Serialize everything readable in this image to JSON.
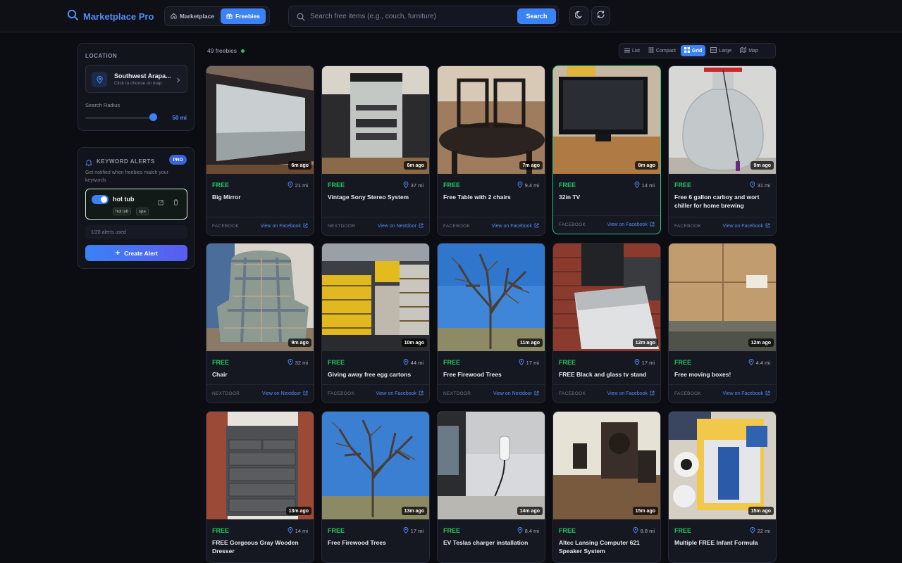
{
  "app": {
    "title": "Marketplace Pro",
    "brand_color": "#4f8cf7"
  },
  "nav": {
    "marketplace_label": "Marketplace",
    "freebies_label": "Freebies",
    "active": "Freebies"
  },
  "search": {
    "placeholder": "Search free items (e.g., couch, furniture)",
    "value": "",
    "button_label": "Search"
  },
  "header_actions": {
    "theme_icon": "moon-icon",
    "refresh_icon": "refresh-icon"
  },
  "sidebar": {
    "location": {
      "heading": "LOCATION",
      "name": "Southwest Arapa...",
      "hint": "Click to choose on map",
      "radius_label": "Search Radius",
      "radius_value": "50 mi",
      "radius_fraction": 0.96
    },
    "alerts": {
      "heading": "KEYWORD ALERTS",
      "badge": "PRO",
      "description": "Get notified when freebies match your keywords",
      "items": [
        {
          "name": "hot tub",
          "enabled": true,
          "tags": [
            "hot tub",
            "spa"
          ]
        }
      ],
      "usage": "1/20 alerts used",
      "create_label": "Create Alert"
    }
  },
  "results": {
    "count_label": "49 freebies",
    "status_color": "#22c55e"
  },
  "views": {
    "options": [
      "List",
      "Compact",
      "Grid",
      "Large",
      "Map"
    ],
    "active": "Grid"
  },
  "items": [
    {
      "price": "FREE",
      "title": "Big Mirror",
      "distance": "21 mi",
      "time": "6m ago",
      "source": "FACEBOOK",
      "link": "View on Facebook"
    },
    {
      "price": "FREE",
      "title": "Vintage Sony Stereo System",
      "distance": "37 mi",
      "time": "6m ago",
      "source": "NEXTDOOR",
      "link": "View on Nextdoor"
    },
    {
      "price": "FREE",
      "title": "Free Table with 2 chairs",
      "distance": "9.4 mi",
      "time": "7m ago",
      "source": "FACEBOOK",
      "link": "View on Facebook"
    },
    {
      "price": "FREE",
      "title": "32in TV",
      "distance": "14 mi",
      "time": "8m ago",
      "source": "FACEBOOK",
      "link": "View on Facebook"
    },
    {
      "price": "FREE",
      "title": "Free 6 gallon carboy and wort chiller for home brewing",
      "distance": "31 mi",
      "time": "9m ago",
      "source": "FACEBOOK",
      "link": "View on Facebook"
    },
    {
      "price": "FREE",
      "title": "Chair",
      "distance": "32 mi",
      "time": "9m ago",
      "source": "NEXTDOOR",
      "link": "View on Nextdoor"
    },
    {
      "price": "FREE",
      "title": "Giving away free egg cartons",
      "distance": "44 mi",
      "time": "10m ago",
      "source": "FACEBOOK",
      "link": "View on Facebook"
    },
    {
      "price": "FREE",
      "title": "Free Firewood Trees",
      "distance": "17 mi",
      "time": "11m ago",
      "source": "NEXTDOOR",
      "link": "View on Nextdoor"
    },
    {
      "price": "FREE",
      "title": "FREE Black and glass tv stand",
      "distance": "17 mi",
      "time": "12m ago",
      "source": "FACEBOOK",
      "link": "View on Facebook"
    },
    {
      "price": "FREE",
      "title": "Free moving boxes!",
      "distance": "4.4 mi",
      "time": "12m ago",
      "source": "FACEBOOK",
      "link": "View on Facebook"
    },
    {
      "price": "FREE",
      "title": "FREE Gorgeous Gray Wooden Dresser",
      "distance": "14 mi",
      "time": "13m ago"
    },
    {
      "price": "FREE",
      "title": "Free Firewood Trees",
      "distance": "17 mi",
      "time": "13m ago"
    },
    {
      "price": "FREE",
      "title": "EV Teslas charger installation",
      "distance": "8.4 mi",
      "time": "14m ago"
    },
    {
      "price": "FREE",
      "title": "Altec Lansing Computer 621 Speaker System",
      "distance": "8.8 mi",
      "time": "15m ago"
    },
    {
      "price": "FREE",
      "title": "Multiple FREE Infant Formula",
      "distance": "22 mi",
      "time": "15m ago"
    }
  ]
}
